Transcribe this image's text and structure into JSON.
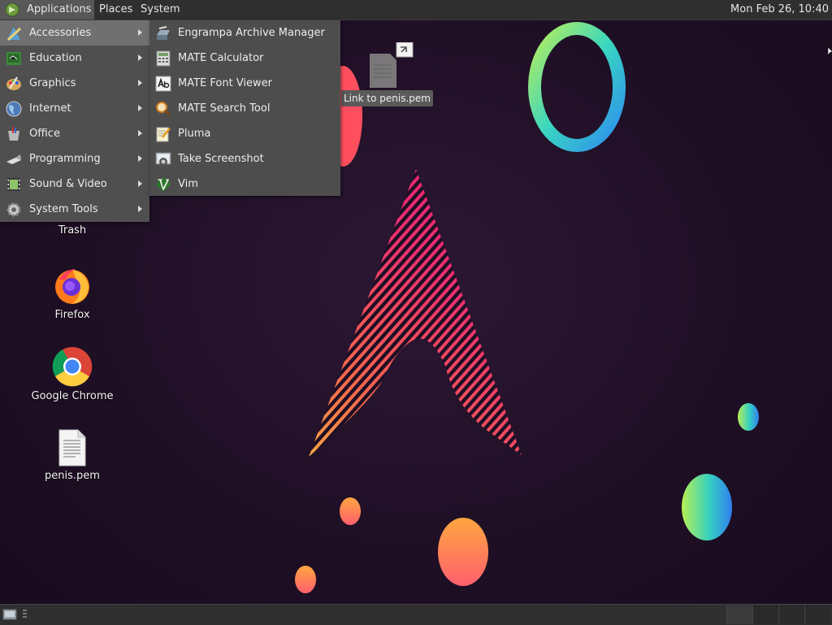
{
  "top_panel": {
    "applications": "Applications",
    "places": "Places",
    "system": "System",
    "clock": "Mon Feb 26, 10:40"
  },
  "categories": [
    {
      "label": "Accessories",
      "icon": "accessories-icon"
    },
    {
      "label": "Education",
      "icon": "education-icon"
    },
    {
      "label": "Graphics",
      "icon": "graphics-icon"
    },
    {
      "label": "Internet",
      "icon": "internet-icon"
    },
    {
      "label": "Office",
      "icon": "office-icon"
    },
    {
      "label": "Programming",
      "icon": "programming-icon"
    },
    {
      "label": "Sound & Video",
      "icon": "sound-video-icon"
    },
    {
      "label": "System Tools",
      "icon": "system-tools-icon"
    }
  ],
  "accessories": [
    {
      "label": "Engrampa Archive Manager",
      "icon": "archive-manager-icon"
    },
    {
      "label": "MATE Calculator",
      "icon": "calculator-icon"
    },
    {
      "label": "MATE Font Viewer",
      "icon": "font-viewer-icon"
    },
    {
      "label": "MATE Search Tool",
      "icon": "search-tool-icon"
    },
    {
      "label": "Pluma",
      "icon": "text-editor-icon"
    },
    {
      "label": "Take Screenshot",
      "icon": "screenshot-icon"
    },
    {
      "label": "Vim",
      "icon": "vim-icon"
    }
  ],
  "desktop_icons": {
    "trash": "Trash",
    "firefox": "Firefox",
    "chrome": "Google Chrome",
    "pem": "penis.pem"
  },
  "tooltip": "Link to penis.pem",
  "colors": {
    "panel": "#2f2f2f",
    "menu_bg": "#4f4f4f",
    "menu_active": "#707070",
    "desktop_bg": "#1f0f25"
  }
}
